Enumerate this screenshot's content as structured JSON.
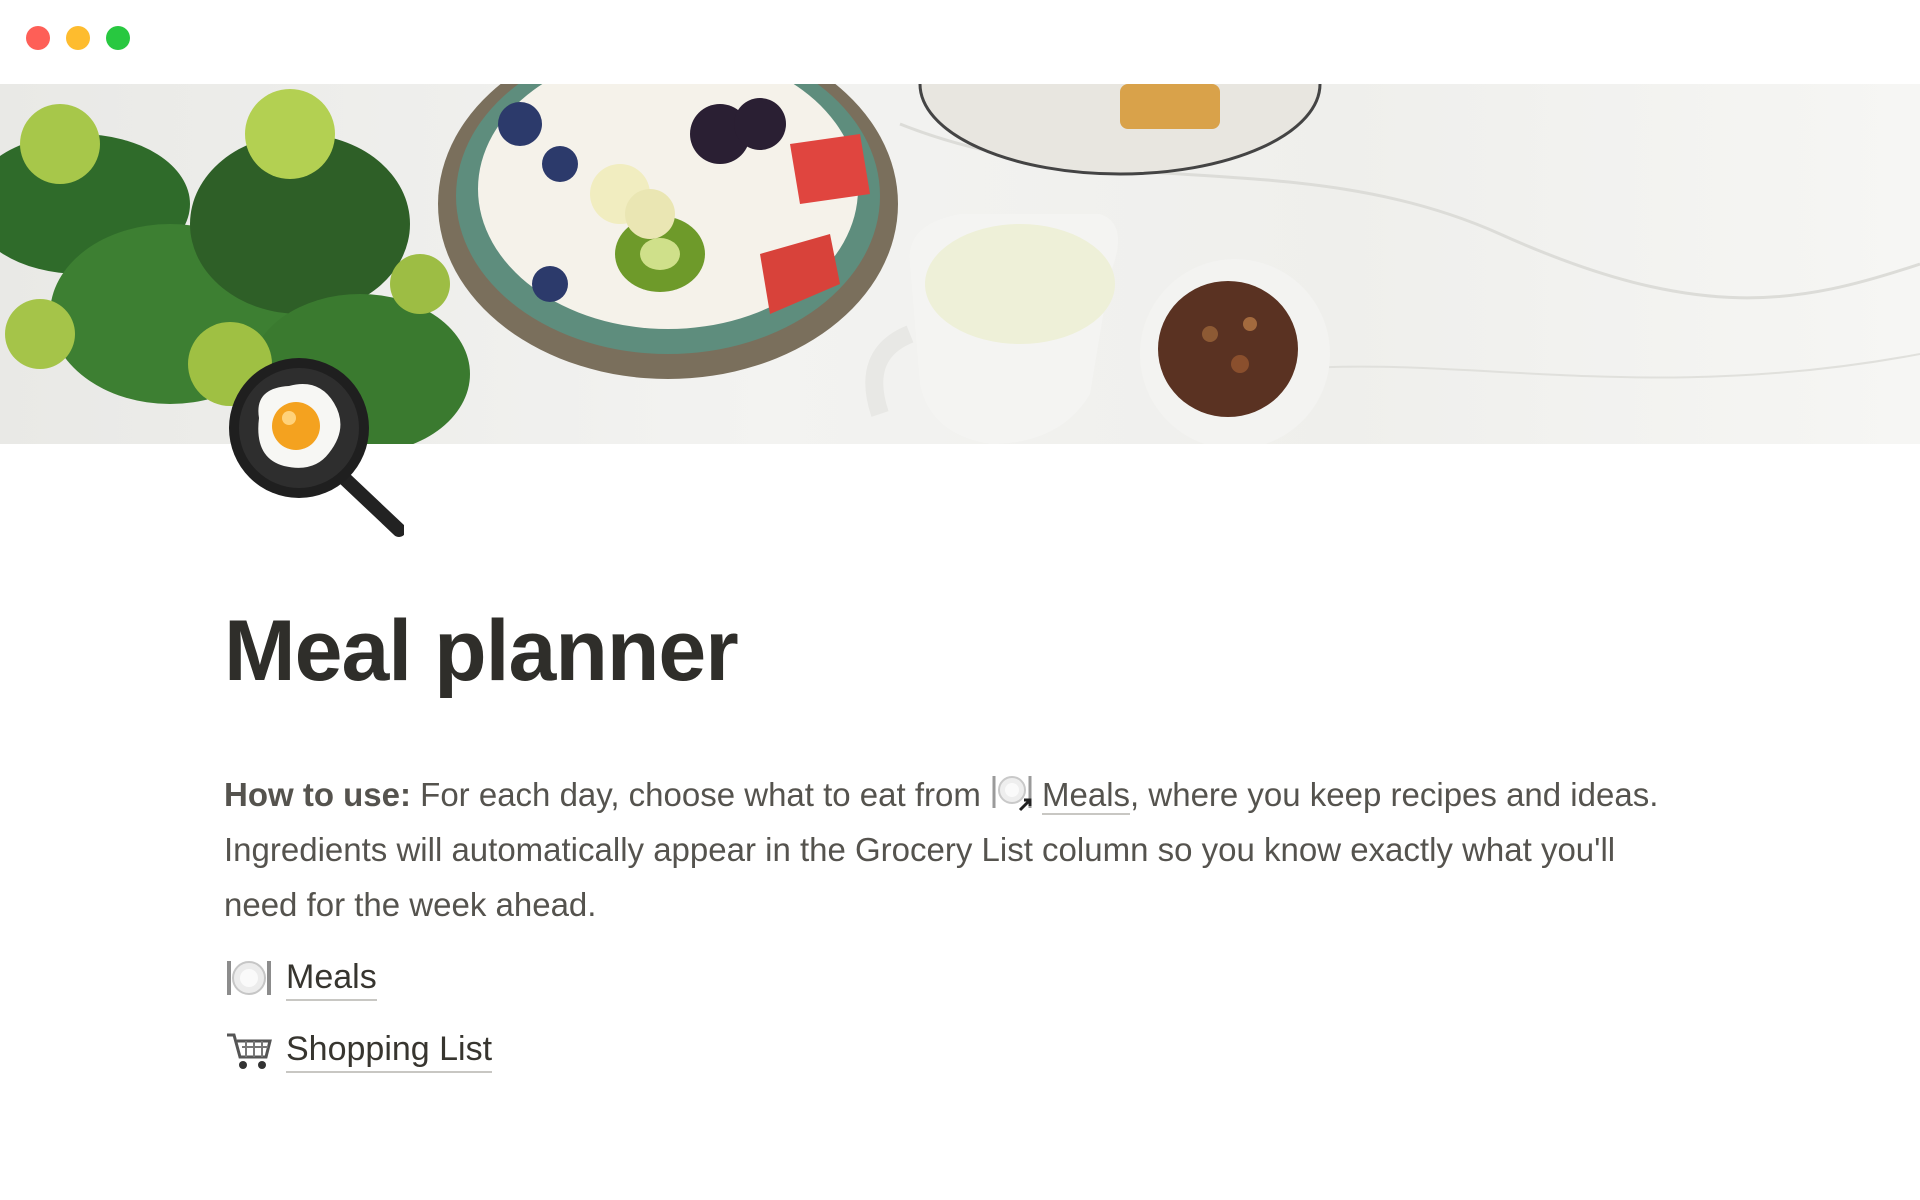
{
  "window": {
    "controls": [
      "close",
      "minimize",
      "maximize"
    ]
  },
  "cover": {
    "description_icon": "food-cover-image"
  },
  "page": {
    "icon": "fried-egg-icon",
    "title": "Meal planner"
  },
  "howto": {
    "label": "How to use:",
    "text_before_link": " For each day, choose what to eat from ",
    "link_icon": "plate-icon",
    "link_text": "Meals",
    "text_after_link": ", where you keep recipes and ideas. Ingredients will automatically appear in the Grocery List column so you know exactly what you'll need for the week ahead."
  },
  "links": [
    {
      "icon": "plate-icon",
      "label": "Meals"
    },
    {
      "icon": "shopping-cart-icon",
      "label": "Shopping List"
    }
  ],
  "colors": {
    "close": "#fe5f57",
    "minimize": "#febc2e",
    "maximize": "#28c840",
    "text": "#37352f",
    "muted_text": "#55534e"
  }
}
